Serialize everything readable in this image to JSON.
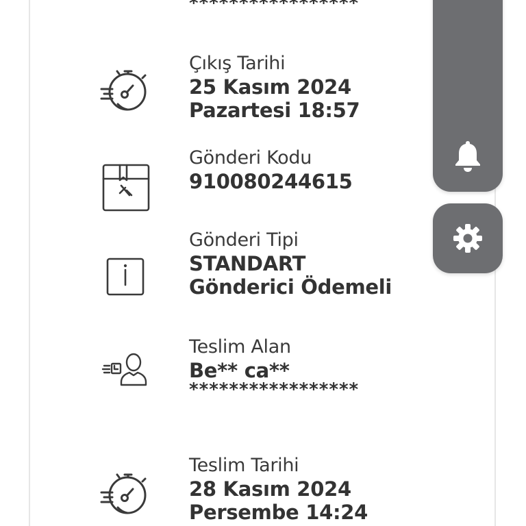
{
  "shipment": {
    "top_mask": "*****************",
    "departure": {
      "label": "Çıkış Tarihi",
      "date": "25 Kasım 2024",
      "day_time": "Pazartesi 18:57",
      "icon": "stopwatch-icon"
    },
    "code": {
      "label": "Gönderi Kodu",
      "value": "910080244615",
      "icon": "package-icon"
    },
    "type": {
      "label": "Gönderi Tipi",
      "value": "STANDART",
      "payment": "Gönderici Ödemeli",
      "icon": "info-icon"
    },
    "receiver": {
      "label": "Teslim Alan",
      "name": "Be** ca**",
      "mask": "*****************",
      "icon": "receiver-person-icon"
    },
    "delivery": {
      "label": "Teslim Tarihi",
      "date": "28 Kasım 2024",
      "day_time": "Persembe 14:24",
      "icon": "stopwatch-icon"
    }
  },
  "floating_actions": {
    "notifications_icon": "bell-icon",
    "settings_icon": "gear-icon",
    "color": "#6d6e71"
  }
}
